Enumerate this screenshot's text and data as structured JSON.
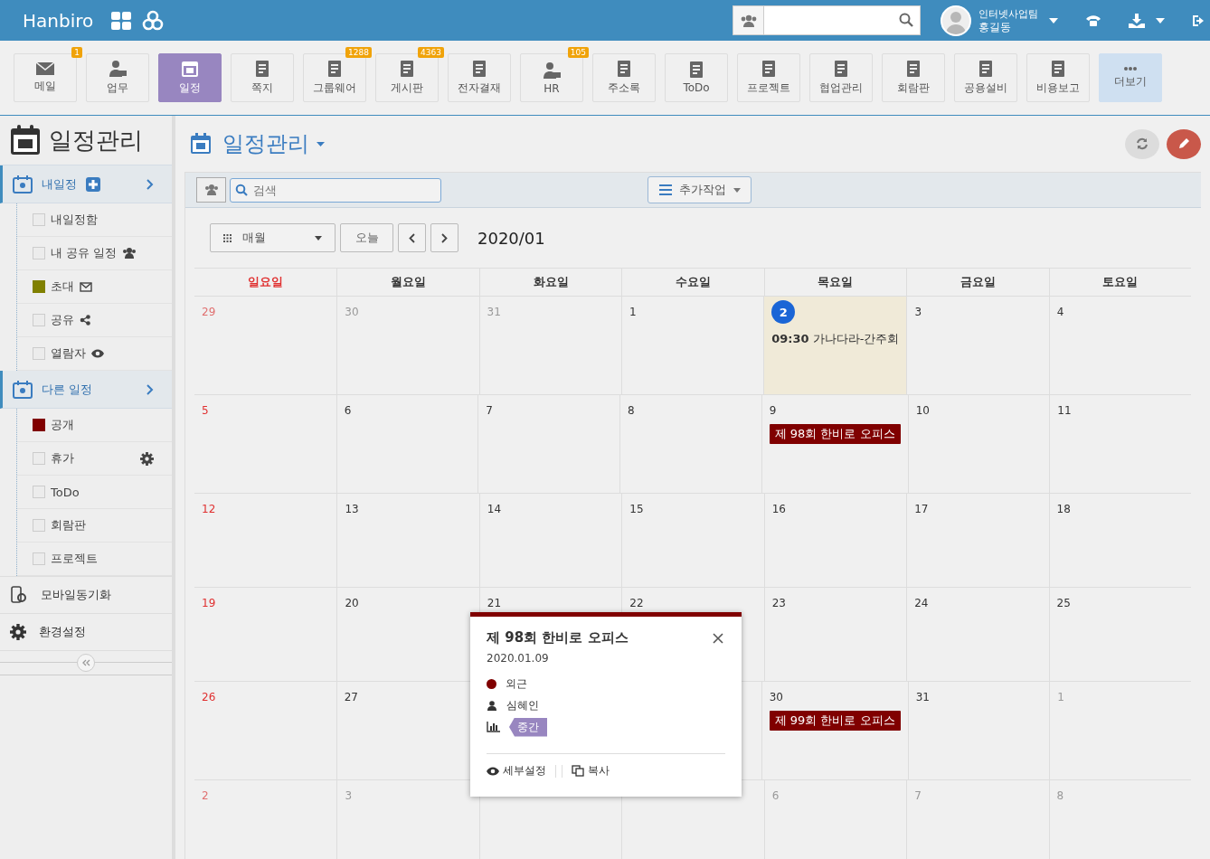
{
  "topbar": {
    "brand": "Hanbiro",
    "user": {
      "team": "인터넷사업팀",
      "name": "홍길동"
    }
  },
  "apps": [
    {
      "label": "메일",
      "badge": "1",
      "selected": false
    },
    {
      "label": "업무",
      "selected": false
    },
    {
      "label": "일정",
      "selected": true
    },
    {
      "label": "쪽지",
      "selected": false
    },
    {
      "label": "그룹웨어",
      "badge": "1288",
      "selected": false
    },
    {
      "label": "게시판",
      "badge": "4363",
      "selected": false
    },
    {
      "label": "전자결재",
      "selected": false
    },
    {
      "label": "HR",
      "badge": "105",
      "selected": false
    },
    {
      "label": "주소록",
      "selected": false
    },
    {
      "label": "ToDo",
      "selected": false
    },
    {
      "label": "프로젝트",
      "selected": false
    },
    {
      "label": "협업관리",
      "selected": false
    },
    {
      "label": "회람판",
      "selected": false
    },
    {
      "label": "공용설비",
      "selected": false
    },
    {
      "label": "비용보고",
      "selected": false
    },
    {
      "label": "더보기",
      "selected": false
    }
  ],
  "sidebar": {
    "title": "일정관리",
    "sections": [
      {
        "label": "내일정",
        "expanded": false,
        "items": [
          {
            "label": "내일정함",
            "checked": false
          },
          {
            "label": "내 공유 일정",
            "checked": false
          },
          {
            "label": "초대",
            "checked": true,
            "color": "#808000"
          },
          {
            "label": "공유",
            "checked": false
          },
          {
            "label": "열람자",
            "checked": false
          }
        ]
      },
      {
        "label": "다른 일정",
        "expanded": false,
        "items": [
          {
            "label": "공개",
            "checked": true,
            "color": "#800000"
          },
          {
            "label": "휴가",
            "checked": false
          },
          {
            "label": "ToDo",
            "checked": false
          },
          {
            "label": "회람판",
            "checked": false
          },
          {
            "label": "프로젝트",
            "checked": false
          }
        ]
      }
    ],
    "links": [
      {
        "label": "모바일동기화"
      },
      {
        "label": "환경설정"
      }
    ]
  },
  "main": {
    "title": "일정관리",
    "filter": {
      "placeholder": "검색",
      "action": "추가작업"
    },
    "view": "매월",
    "today": "오늘",
    "period": "2020/01"
  },
  "calendar": {
    "weekdays": [
      "일요일",
      "월요일",
      "화요일",
      "수요일",
      "목요일",
      "금요일",
      "토요일"
    ],
    "weeks": [
      [
        {
          "num": "29",
          "other": true
        },
        {
          "num": "30",
          "other": true
        },
        {
          "num": "31",
          "other": true
        },
        {
          "num": "1",
          "other": false
        },
        {
          "num": "2",
          "other": false,
          "today": true,
          "events": [
            {
              "time": "09:30",
              "title": "가나다라-간주회",
              "kind": "text"
            }
          ]
        },
        {
          "num": "3",
          "other": false
        },
        {
          "num": "4",
          "other": false
        }
      ],
      [
        {
          "num": "5",
          "other": false
        },
        {
          "num": "6",
          "other": false
        },
        {
          "num": "7",
          "other": false
        },
        {
          "num": "8",
          "other": false
        },
        {
          "num": "9",
          "other": false,
          "events": [
            {
              "title": "제 98회 한비로 오피스",
              "kind": "bar",
              "color": "#800000"
            }
          ]
        },
        {
          "num": "10",
          "other": false
        },
        {
          "num": "11",
          "other": false
        }
      ],
      [
        {
          "num": "12",
          "other": false
        },
        {
          "num": "13",
          "other": false
        },
        {
          "num": "14",
          "other": false
        },
        {
          "num": "15",
          "other": false
        },
        {
          "num": "16",
          "other": false
        },
        {
          "num": "17",
          "other": false
        },
        {
          "num": "18",
          "other": false
        }
      ],
      [
        {
          "num": "19",
          "other": false
        },
        {
          "num": "20",
          "other": false
        },
        {
          "num": "21",
          "other": false
        },
        {
          "num": "22",
          "other": false
        },
        {
          "num": "23",
          "other": false
        },
        {
          "num": "24",
          "other": false
        },
        {
          "num": "25",
          "other": false
        }
      ],
      {
        "start": [
          {
            "num": "26",
            "other": false
          },
          {
            "num": "27",
            "other": false
          }
        ],
        "end": [
          {
            "num": "30",
            "other": false,
            "events": [
              {
                "title": "제 99회 한비로 오피스",
                "kind": "bar",
                "color": "#800000"
              }
            ]
          },
          {
            "num": "31",
            "other": false
          },
          {
            "num": "1",
            "other": true
          }
        ]
      },
      {
        "start": [
          {
            "num": "2",
            "other": true
          },
          {
            "num": "3",
            "other": true
          }
        ],
        "end": [
          {
            "num": "6",
            "other": true
          },
          {
            "num": "7",
            "other": true
          },
          {
            "num": "8",
            "other": true
          }
        ]
      }
    ]
  },
  "popup": {
    "title": "제 98회 한비로 오피스",
    "date": "2020.01.09",
    "category": {
      "label": "외근",
      "color": "#800000"
    },
    "person": "심혜인",
    "priority": "중간",
    "actions": [
      "세부설정",
      "복사"
    ]
  }
}
